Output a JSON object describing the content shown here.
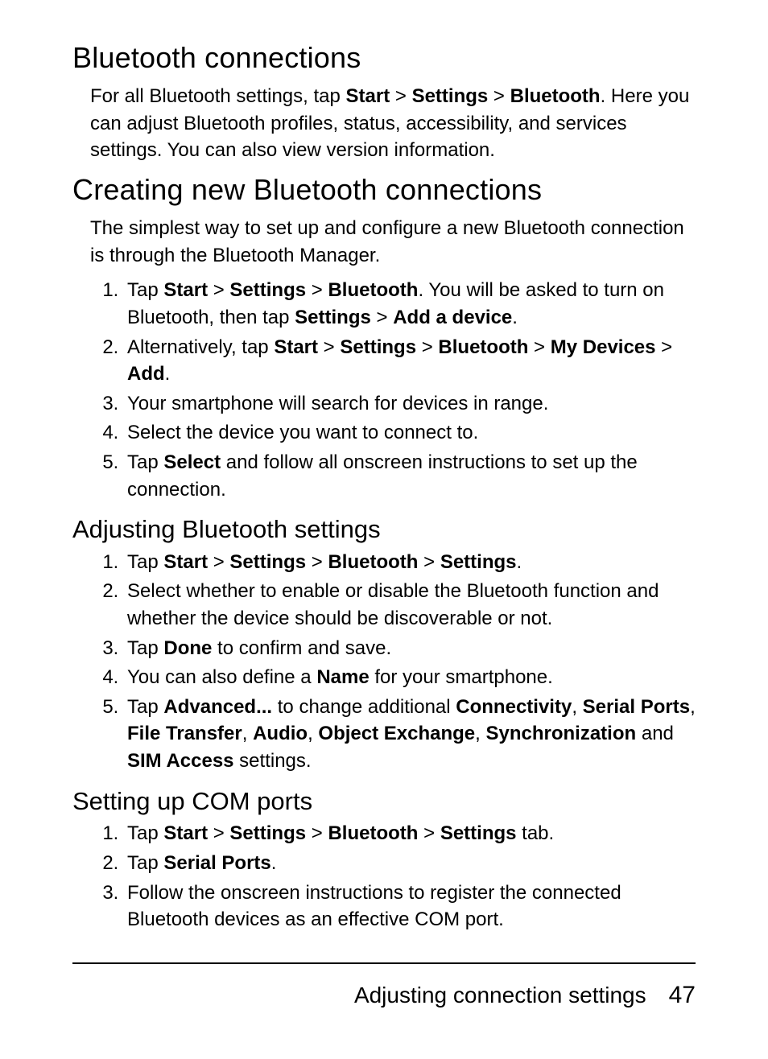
{
  "h1a": "Bluetooth connections",
  "p1_pre": "For all Bluetooth settings, tap ",
  "p1_start": "Start",
  "p1_gt1": " > ",
  "p1_settings": "Settings",
  "p1_gt2": " > ",
  "p1_bt": "Bluetooth",
  "p1_rest": ". Here you can adjust Bluetooth profiles, status, accessibility, and services settings. You can also view version information.",
  "h1b": "Creating new Bluetooth connections",
  "p2": "The simplest way to set up and configure a new Bluetooth connection is through the Bluetooth Manager.",
  "ol1": {
    "i1_a": "Tap ",
    "i1_start": "Start",
    "i1_b": " > ",
    "i1_settings": "Settings",
    "i1_c": " > ",
    "i1_bt": "Bluetooth",
    "i1_d": ". You will be asked to turn on Bluetooth, then tap ",
    "i1_settings2": "Settings",
    "i1_e": " > ",
    "i1_add": "Add a device",
    "i1_f": ".",
    "i2_a": "Alternatively, tap ",
    "i2_start": "Start",
    "i2_b": " > ",
    "i2_settings": "Settings",
    "i2_c": " > ",
    "i2_bt": "Bluetooth",
    "i2_d": " > ",
    "i2_mydev": "My Devices",
    "i2_e": " > ",
    "i2_add": "Add",
    "i2_f": ".",
    "i3": "Your smartphone will search for devices in range.",
    "i4": "Select the device you want to connect to.",
    "i5_a": "Tap ",
    "i5_select": "Select",
    "i5_b": " and follow all onscreen instructions to set up the connection."
  },
  "h2a": "Adjusting Bluetooth settings",
  "ol2": {
    "i1_a": "Tap ",
    "i1_start": "Start",
    "i1_b": " > ",
    "i1_settings1": "Settings",
    "i1_c": " > ",
    "i1_bt": "Bluetooth",
    "i1_d": " > ",
    "i1_settings2": "Settings",
    "i1_e": ".",
    "i2": "Select whether to enable or disable the Bluetooth function and whether the device should be discoverable or not.",
    "i3_a": "Tap ",
    "i3_done": "Done",
    "i3_b": " to confirm and save.",
    "i4_a": "You can also define a ",
    "i4_name": "Name",
    "i4_b": " for your smartphone.",
    "i5_a": "Tap ",
    "i5_adv": "Advanced...",
    "i5_b": " to change additional ",
    "i5_conn": "Connectivity",
    "i5_c": ", ",
    "i5_sp": "Serial Ports",
    "i5_d": ", ",
    "i5_ft": "File Transfer",
    "i5_e": ", ",
    "i5_audio": "Audio",
    "i5_f": ", ",
    "i5_oe": "Object Exchange",
    "i5_g": ", ",
    "i5_sync": "Synchroniza­tion",
    "i5_h": " and ",
    "i5_sim": "SIM Access",
    "i5_i": " settings."
  },
  "h2b": "Setting up COM ports",
  "ol3": {
    "i1_a": "Tap ",
    "i1_start": "Start",
    "i1_b": " > ",
    "i1_settings1": "Settings",
    "i1_c": " > ",
    "i1_bt": "Bluetooth",
    "i1_d": " > ",
    "i1_settings2": "Settings",
    "i1_e": " tab.",
    "i2_a": "Tap ",
    "i2_sp": "Serial Ports",
    "i2_b": ".",
    "i3": "Follow the onscreen instructions to register the connected Bluetooth devices as an effective COM port."
  },
  "footer_title": "Adjusting connection settings",
  "footer_page": "47"
}
